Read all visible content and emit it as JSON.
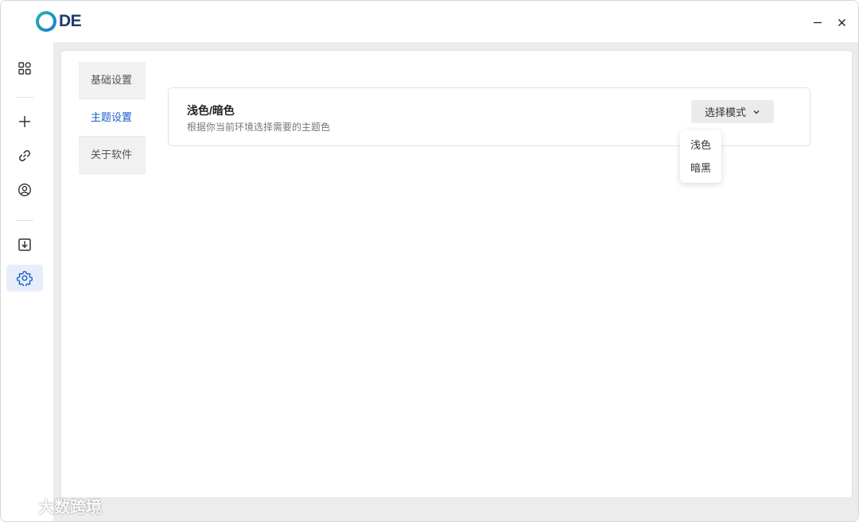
{
  "app": {
    "logo_text": "DE",
    "brand_color": "#1f3b6e"
  },
  "window_controls": {
    "minimize_symbol": "—",
    "close_symbol": "✕"
  },
  "sidebar": {
    "items": [
      {
        "icon": "grid-icon"
      },
      {
        "icon": "plus-icon"
      },
      {
        "icon": "link-icon"
      },
      {
        "icon": "user-circle-icon"
      },
      {
        "icon": "download-icon"
      },
      {
        "icon": "gear-icon",
        "active": true
      }
    ],
    "accent": "#1a5fc8"
  },
  "tabs": [
    {
      "label": "基础设置",
      "active": false
    },
    {
      "label": "主题设置",
      "active": true
    },
    {
      "label": "关于软件",
      "active": false
    }
  ],
  "theme_setting": {
    "title": "浅色/暗色",
    "description": "根据你当前环境选择需要的主题色",
    "select_label": "选择模式",
    "options": [
      "浅色",
      "暗黑"
    ]
  },
  "watermark": {
    "text": "大数跨境"
  }
}
